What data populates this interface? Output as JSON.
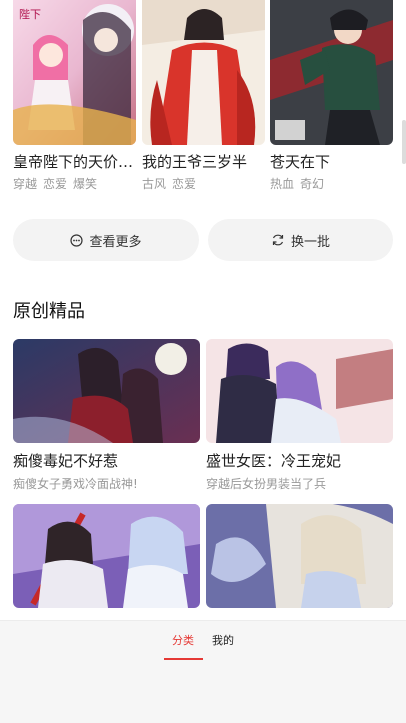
{
  "top_row": [
    {
      "title": "皇帝陛下的天价…",
      "tags": [
        "穿越",
        "恋爱",
        "爆笑"
      ]
    },
    {
      "title": "我的王爷三岁半",
      "tags": [
        "古风",
        "恋爱"
      ]
    },
    {
      "title": "苍天在下",
      "tags": [
        "热血",
        "奇幻"
      ]
    }
  ],
  "actions": {
    "more_label": "查看更多",
    "refresh_label": "换一批"
  },
  "section": {
    "title": "原创精品"
  },
  "original_row1": [
    {
      "title": "痴傻毒妃不好惹",
      "desc": "痴傻女子勇戏冷面战神!"
    },
    {
      "title": "盛世女医：冷王宠妃",
      "desc": "穿越后女扮男装当了兵"
    }
  ],
  "original_row2_partial": [
    {
      "title": ""
    },
    {
      "title": ""
    }
  ],
  "tabs": {
    "category": "分类",
    "mine": "我的"
  },
  "colors": {
    "accent": "#e53935",
    "muted_text": "#999999",
    "button_bg": "#f3f3f3"
  }
}
